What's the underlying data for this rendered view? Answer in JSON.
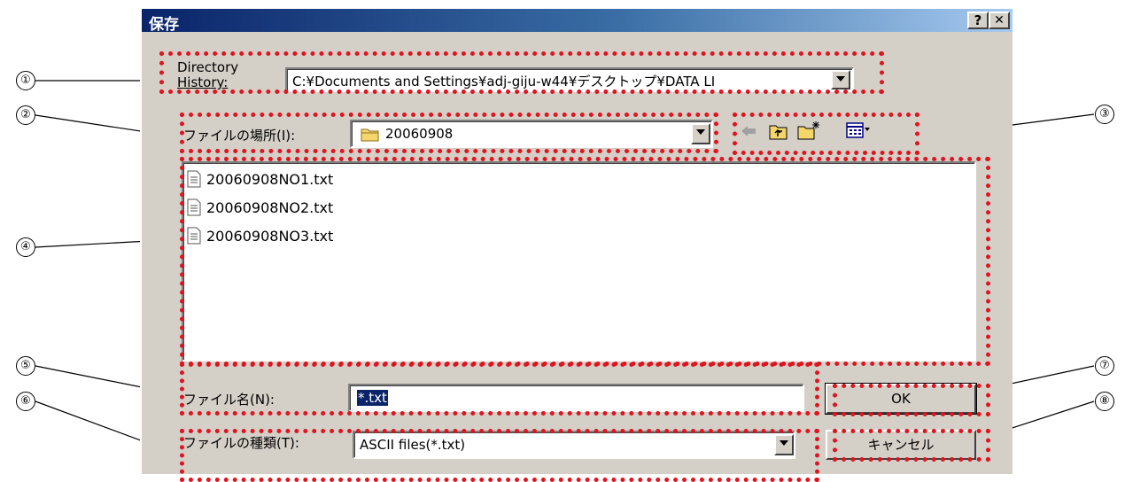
{
  "dialog": {
    "title": "保存",
    "help_label": "?",
    "close_label": "✕"
  },
  "directory_history": {
    "label_line1": "Directory",
    "label_line2": "History:",
    "value": "C:¥Documents and Settings¥adj-giju-w44¥デスクトップ¥DATA LI"
  },
  "location": {
    "label": "ファイルの場所(I):",
    "folder": "20060908"
  },
  "toolbar": {
    "icons": [
      "back-arrow-icon",
      "up-folder-icon",
      "new-folder-icon",
      "view-menu-icon"
    ]
  },
  "files": [
    {
      "name": "20060908NO1.txt"
    },
    {
      "name": "20060908NO2.txt"
    },
    {
      "name": "20060908NO3.txt"
    }
  ],
  "filename": {
    "label": "ファイル名(N):",
    "value": "*.txt"
  },
  "filetype": {
    "label": "ファイルの種類(T):",
    "value": "ASCII files(*.txt)"
  },
  "buttons": {
    "ok": "OK",
    "cancel": "キャンセル"
  },
  "callouts": [
    "①",
    "②",
    "③",
    "④",
    "⑤",
    "⑥",
    "⑦",
    "⑧"
  ],
  "colors": {
    "highlight": "#e0141e",
    "titlebar_start": "#0a246a",
    "titlebar_end": "#a6caf0",
    "selection": "#0a246a"
  }
}
